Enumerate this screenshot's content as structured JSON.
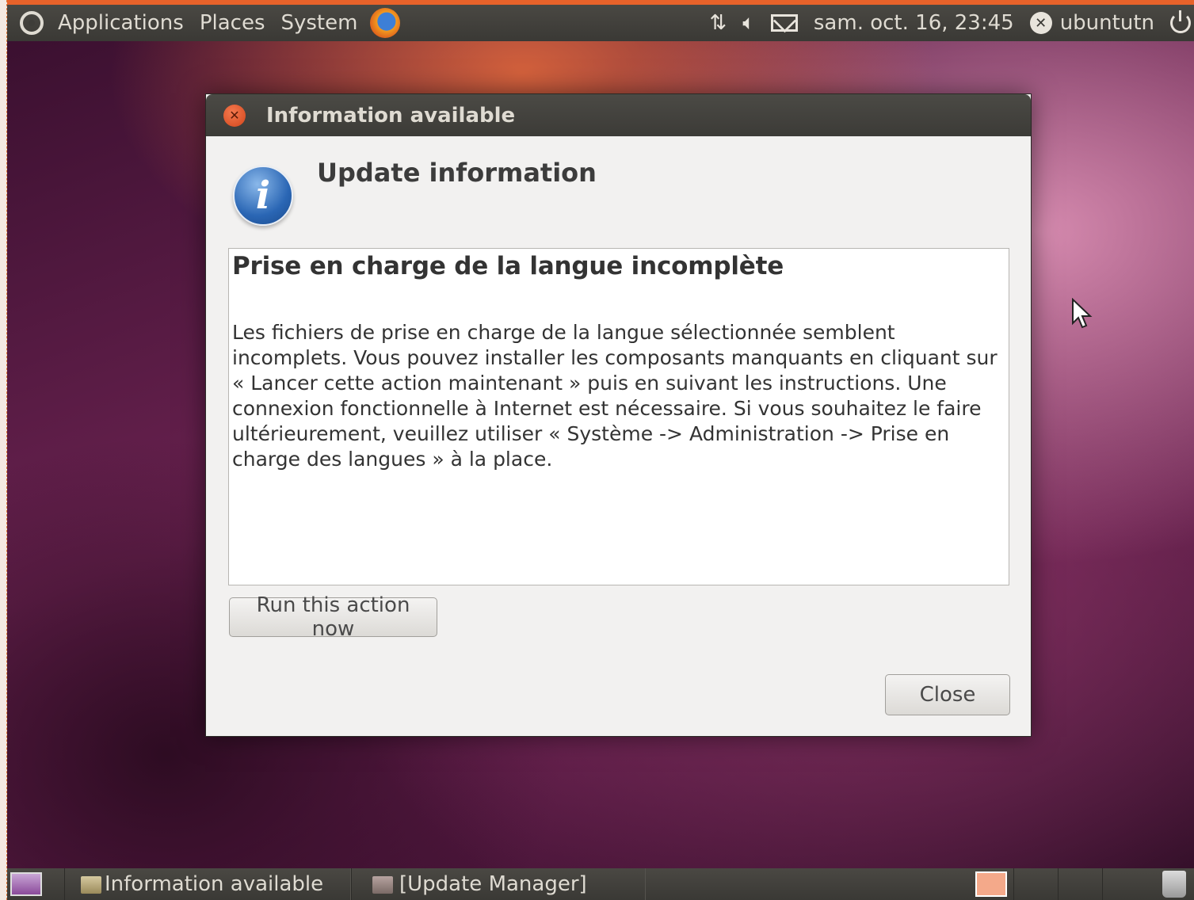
{
  "top_panel": {
    "menus": [
      "Applications",
      "Places",
      "System"
    ],
    "datetime": "sam. oct. 16, 23:45",
    "user": "ubuntutn"
  },
  "dialog": {
    "title": "Information available",
    "heading": "Update information",
    "content_title": "Prise en charge de la langue incomplète",
    "content_body": "Les fichiers de prise en charge de la langue sélectionnée semblent incomplets. Vous pouvez installer les composants manquants en cliquant sur « Lancer cette action maintenant » puis en suivant les instructions. Une connexion fonctionnelle à Internet est nécessaire. Si vous souhaitez le faire ultérieurement, veuillez utiliser « Système -> Administration -> Prise en charge des langues » à la place.",
    "run_button": "Run this action now",
    "close_button": "Close"
  },
  "taskbar": {
    "tasks": [
      "Information available",
      "[Update Manager]"
    ]
  },
  "colors": {
    "accent": "#e8622a",
    "panel": "#3c3b37"
  }
}
